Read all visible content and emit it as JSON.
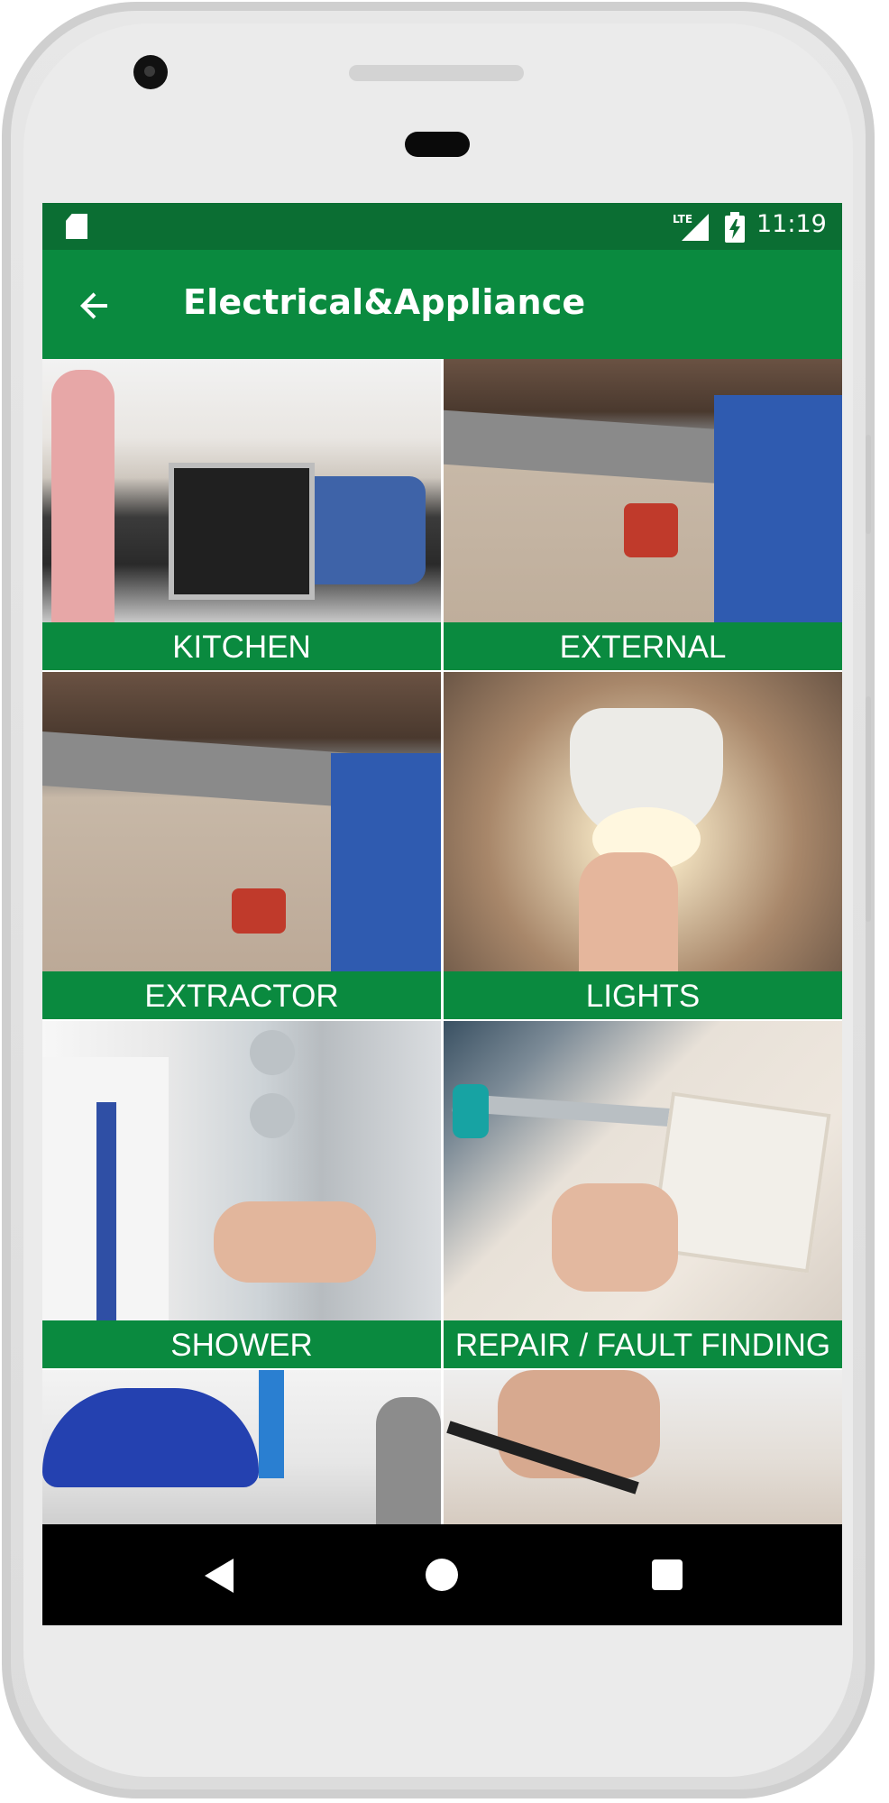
{
  "status_bar": {
    "network": "LTE",
    "time": "11:19"
  },
  "app_bar": {
    "title": "Electrical&Appliance"
  },
  "categories": [
    {
      "label": "KITCHEN"
    },
    {
      "label": "EXTERNAL"
    },
    {
      "label": "EXTRACTOR"
    },
    {
      "label": "LIGHTS"
    },
    {
      "label": "SHOWER"
    },
    {
      "label": "REPAIR / FAULT FINDING"
    }
  ],
  "colors": {
    "status_bar": "#0b6e33",
    "app_bar": "#0a8a3f",
    "label_bar": "#0a8a3f",
    "nav_bar": "#000000"
  },
  "icons": {
    "status_left": "sd-card-icon",
    "signal": "lte-signal-icon",
    "battery": "battery-charging-icon",
    "back": "arrow-left-icon",
    "nav_back": "triangle-back-icon",
    "nav_home": "circle-home-icon",
    "nav_recents": "square-recents-icon"
  }
}
